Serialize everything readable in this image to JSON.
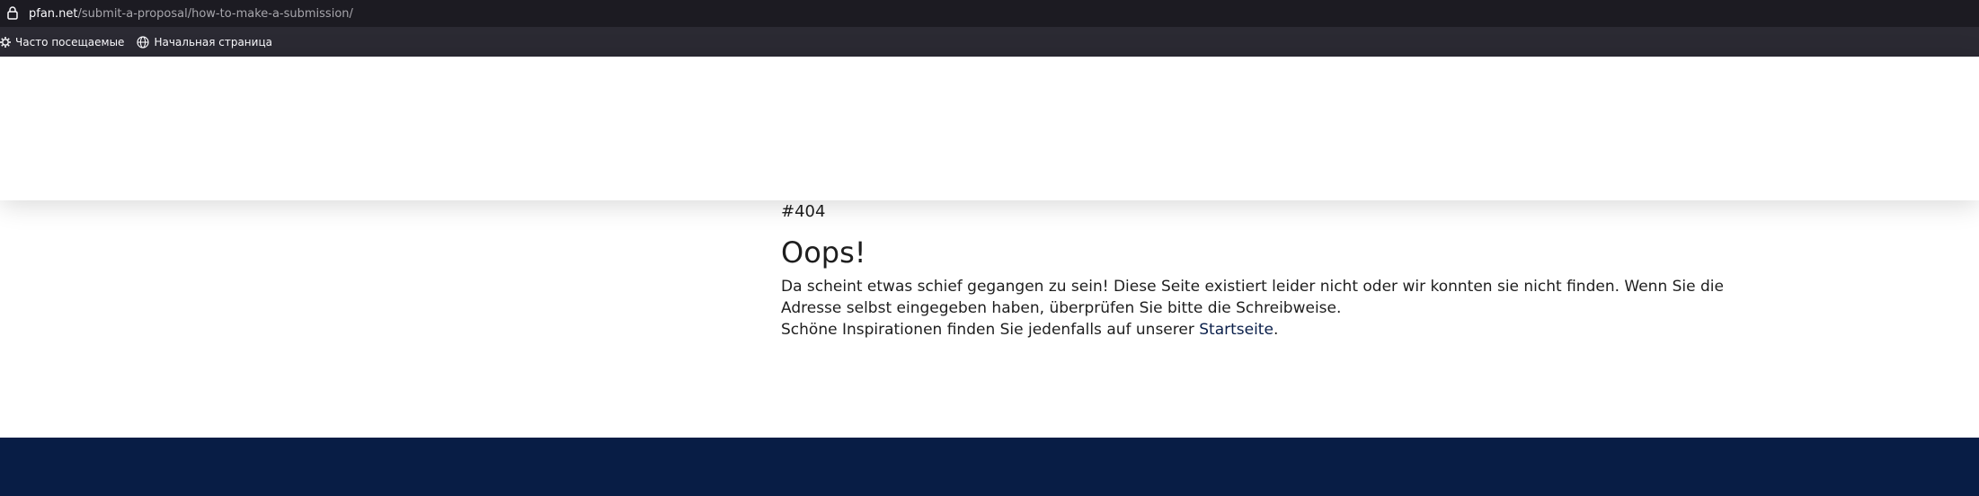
{
  "browser": {
    "url_domain": "pfan.net",
    "url_path": "/submit-a-proposal/how-to-make-a-submission/",
    "lock_icon": "lock-icon",
    "bookmarks": [
      {
        "label": "Часто посещаемые",
        "icon": "gear-icon"
      },
      {
        "label": "Начальная страница",
        "icon": "globe-icon"
      }
    ]
  },
  "page": {
    "error_code": "#404",
    "title": "Oops!",
    "message_line1": "Da scheint etwas schief gegangen zu sein! Diese Seite existiert leider nicht oder wir konnten sie nicht finden. Wenn Sie die Adresse selbst eingegeben haben, überprüfen Sie bitte die Schreibweise.",
    "message_line2_prefix": "Schöne Inspirationen finden Sie jedenfalls auf unserer ",
    "home_link_label": "Startseite",
    "message_line2_suffix": "."
  },
  "colors": {
    "urlbar_bg": "#1c1b22",
    "bookmarks_bg": "#2b2a33",
    "footer_bg": "#081d45",
    "link": "#0a1f4a"
  }
}
